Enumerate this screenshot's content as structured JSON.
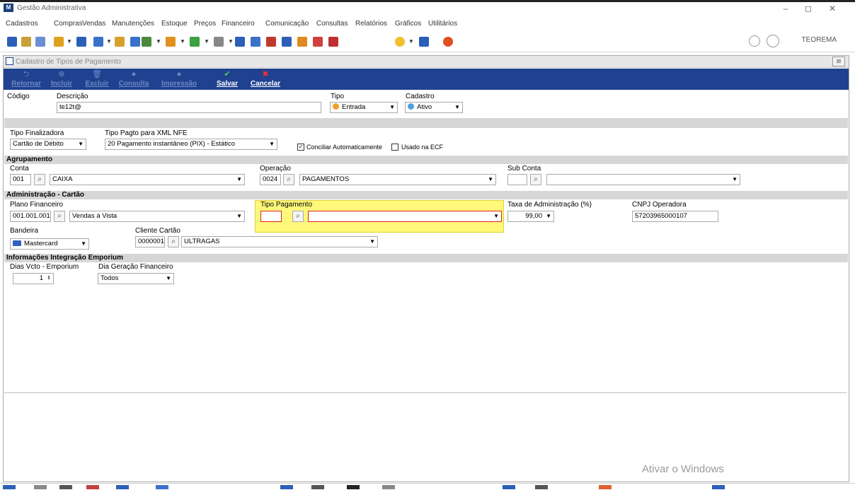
{
  "window": {
    "title": "Gestão Administrativa",
    "user": "TEOREMA"
  },
  "menu": [
    "Cadastros",
    "Compras",
    "Vendas",
    "Manutenções",
    "Estoque",
    "Preços",
    "Financeiro",
    "Comunicação",
    "Consultas",
    "Relatórios",
    "Gráficos",
    "Utilitários"
  ],
  "form": {
    "title": "Cadastro de Tipos de Pagamento"
  },
  "ribbon": {
    "retornar": "Retornar",
    "incluir": "Incluir",
    "excluir": "Excluir",
    "consulta": "Consulta",
    "impressao": "Impressão",
    "salvar": "Salvar",
    "cancelar": "Cancelar"
  },
  "header": {
    "codigo_label": "Código",
    "descricao_label": "Descrição",
    "descricao_value": "te12t@",
    "tipo_label": "Tipo",
    "tipo_value": "Entrada",
    "cadastro_label": "Cadastro",
    "cadastro_value": "Ativo"
  },
  "finalizadora": {
    "tipo_finalizadora_label": "Tipo Finalizadora",
    "tipo_finalizadora_value": "Cartão de Débito",
    "xml_label": "Tipo Pagto para XML NFE",
    "xml_value": "20 Pagamento instantâneo (PIX) - Estático",
    "conciliar_label": "Conciliar Automaticamente",
    "conciliar_checked": true,
    "ecf_label": "Usado na ECF",
    "ecf_checked": false
  },
  "agrupamento": {
    "section": "Agrupamento",
    "conta_label": "Conta",
    "conta_code": "001",
    "conta_value": "CAIXA",
    "operacao_label": "Operação",
    "operacao_code": "0024",
    "operacao_value": "PAGAMENTOS",
    "subconta_label": "Sub Conta",
    "subconta_code": "",
    "subconta_value": ""
  },
  "cartao": {
    "section": "Administração - Cartão",
    "plano_label": "Plano Financeiro",
    "plano_code": "001.001.001",
    "plano_value": "Vendas à Vista",
    "tipo_pag_label": "Tipo Pagamento",
    "tipo_pag_code": "",
    "tipo_pag_value": "",
    "taxa_label": "Taxa de Administração (%)",
    "taxa_value": "99,00",
    "cnpj_label": "CNPJ Operadora",
    "cnpj_value": "57203965000107",
    "bandeira_label": "Bandeira",
    "bandeira_value": "Mastercard",
    "cliente_label": "Cliente Cartão",
    "cliente_code": "0000001",
    "cliente_value": "ULTRAGAS"
  },
  "emporium": {
    "section": "Informações Integração Emporium",
    "dias_label": "Dias Vcto - Emporium",
    "dias_value": "1",
    "dia_ger_label": "Dia Geração Financeiro",
    "dia_ger_value": "Todos"
  },
  "watermark": "Ativar o Windows",
  "colors": {
    "ribbon": "#1f4190",
    "highlight": "#fff87a",
    "required": "#e02020"
  }
}
